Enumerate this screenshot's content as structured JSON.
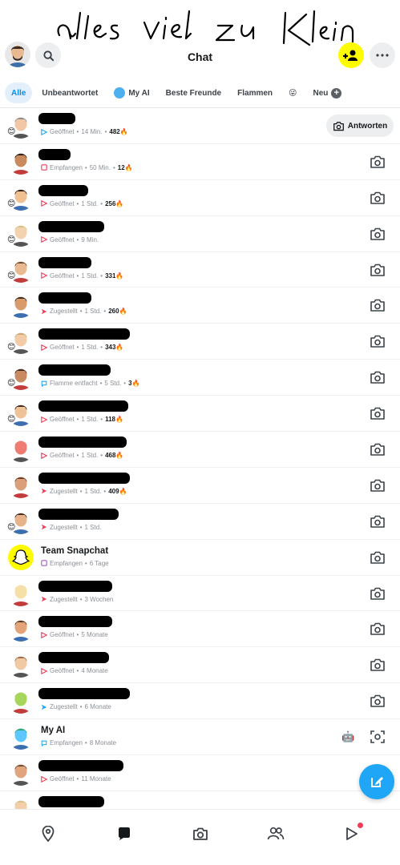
{
  "annotation": {
    "handwritten_text": "alles viel zu Klein"
  },
  "header": {
    "title": "Chat"
  },
  "filters": [
    {
      "label": "Alle",
      "active": true
    },
    {
      "label": "Unbeantwortet"
    },
    {
      "label": "My AI"
    },
    {
      "label": "Beste Freunde"
    },
    {
      "label": "Flammen"
    },
    {
      "label": "😜"
    },
    {
      "label": "Neu"
    }
  ],
  "chats": [
    {
      "name": "",
      "status": "Geöffnet",
      "time": "14 Min.",
      "streak": "482🔥",
      "icon": "sent-open",
      "emoji": "😊",
      "reply": "Antworten"
    },
    {
      "name": "",
      "status": "Empfangen",
      "time": "50 Min.",
      "streak": "12🔥",
      "icon": "received-red"
    },
    {
      "name": "",
      "status": "Geöffnet",
      "time": "1 Std.",
      "streak": "256🔥",
      "icon": "sent-open-red",
      "emoji": "😊"
    },
    {
      "name": "",
      "status": "Geöffnet",
      "time": "9 Min.",
      "streak": "",
      "icon": "sent-open-red",
      "emoji": "😊"
    },
    {
      "name": "",
      "status": "Geöffnet",
      "time": "1 Std.",
      "streak": "331🔥",
      "icon": "sent-open-red",
      "emoji": "😊"
    },
    {
      "name": "",
      "status": "Zugestellt",
      "time": "1 Std.",
      "streak": "260🔥",
      "icon": "sent-red"
    },
    {
      "name": "",
      "status": "Geöffnet",
      "time": "1 Std.",
      "streak": "343🔥",
      "icon": "sent-open-red",
      "emoji": "😊"
    },
    {
      "name": "",
      "status": "Flamme entfacht",
      "time": "5 Std.",
      "streak": "3🔥",
      "icon": "chat-blue",
      "emoji": "😊"
    },
    {
      "name": "",
      "status": "Geöffnet",
      "time": "1 Std.",
      "streak": "118🔥",
      "icon": "sent-open-red",
      "emoji": "😊"
    },
    {
      "name": "",
      "status": "Geöffnet",
      "time": "1 Std.",
      "streak": "468🔥",
      "icon": "sent-open-red"
    },
    {
      "name": "",
      "status": "Zugestellt",
      "time": "1 Std.",
      "streak": "409🔥",
      "icon": "sent-red"
    },
    {
      "name": "",
      "status": "Zugestellt",
      "time": "1 Std.",
      "streak": "",
      "icon": "sent-red",
      "emoji": "😊"
    },
    {
      "name": "Team Snapchat",
      "status": "Empfangen",
      "time": "6 Tage",
      "streak": "",
      "icon": "received-purple"
    },
    {
      "name": "",
      "status": "Zugestellt",
      "time": "3 Wochen",
      "streak": "",
      "icon": "sent-red"
    },
    {
      "name": "",
      "status": "Geöffnet",
      "time": "5 Monate",
      "streak": "",
      "icon": "sent-open-red"
    },
    {
      "name": "",
      "status": "Geöffnet",
      "time": "4 Monate",
      "streak": "",
      "icon": "sent-open-red"
    },
    {
      "name": "",
      "status": "Zugestellt",
      "time": "6 Monate",
      "streak": "",
      "icon": "sent-blue"
    },
    {
      "name": "My AI",
      "status": "Empfangen",
      "time": "8 Monate",
      "streak": "",
      "icon": "received-blue"
    },
    {
      "name": "",
      "status": "Geöffnet",
      "time": "11 Monate",
      "streak": "",
      "icon": "sent-open-red"
    },
    {
      "name": "",
      "status": "",
      "time": "",
      "streak": "",
      "icon": ""
    }
  ],
  "colors": {
    "snap_yellow": "#fffc00",
    "accent_blue": "#0e8de8",
    "sent_red": "#f23c57",
    "chat_blue": "#1fa6f6",
    "received_purple": "#a05dcd"
  },
  "nav": [
    "map-icon",
    "chat-icon",
    "camera-icon",
    "friends-icon",
    "stories-icon"
  ]
}
